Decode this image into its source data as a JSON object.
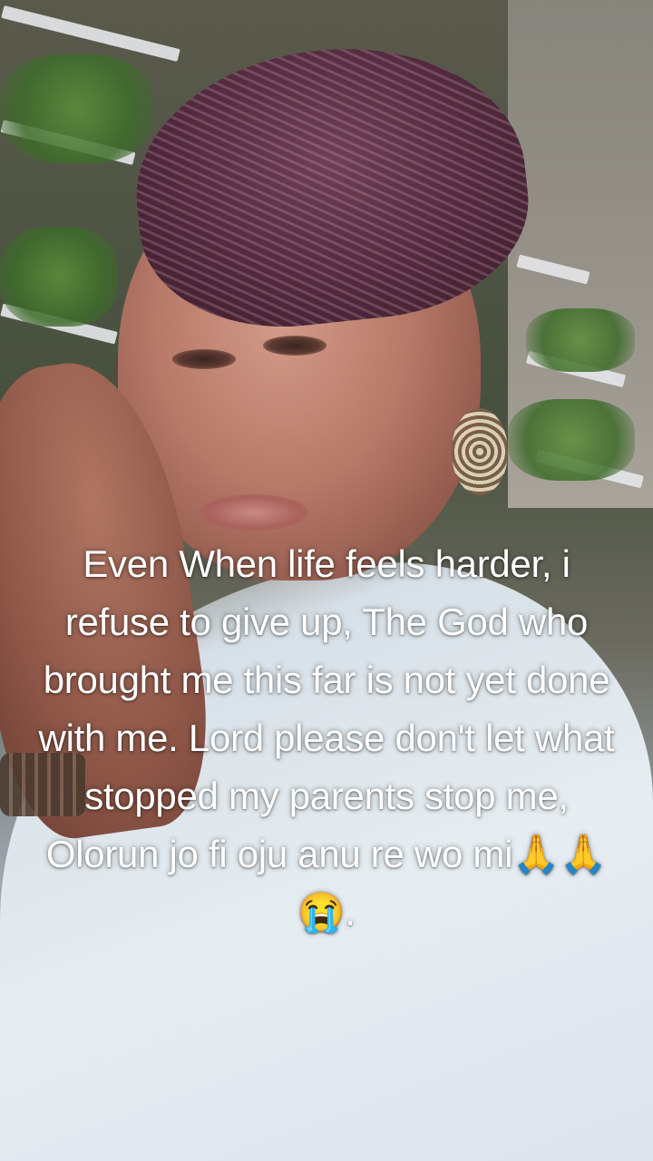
{
  "overlay": {
    "caption": "Even When life feels harder, i refuse to give up, The God who brought me this far is not yet done with me. Lord please don't let what stopped my parents stop me, Olorun jo fi oju anu re wo mi🙏🙏😭."
  }
}
